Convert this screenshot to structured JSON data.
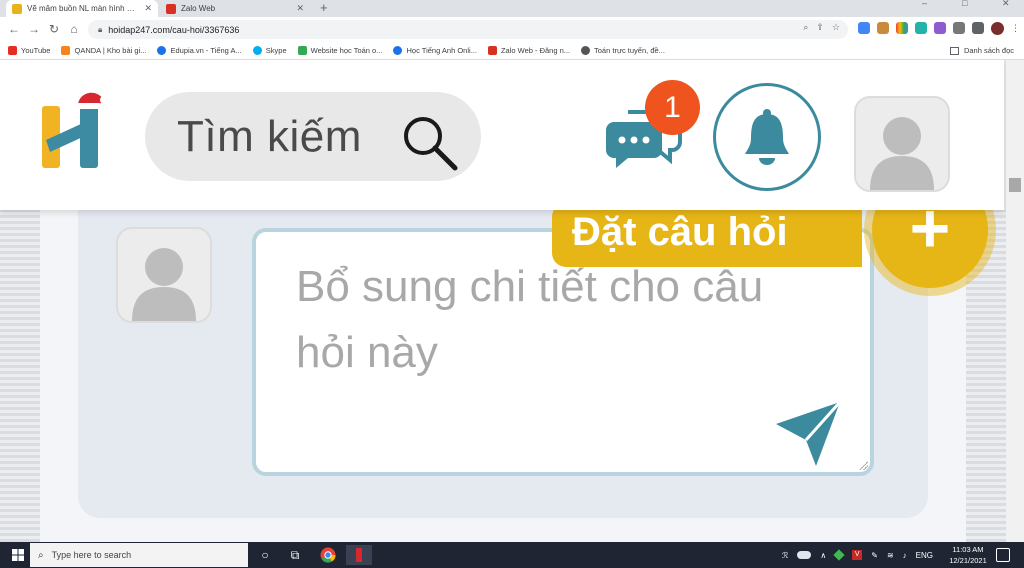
{
  "browser": {
    "tabs": [
      {
        "title": "Vẽ mâm buồn NL màn hình máy",
        "active": true,
        "favicon_color": "#e8b21b"
      },
      {
        "title": "Zalo Web",
        "active": false,
        "favicon_color": "#d93025"
      }
    ],
    "new_tab_glyph": "+",
    "window_controls": [
      "–",
      "□",
      "✕"
    ],
    "url": "hoidap247.com/cau-hoi/3367636",
    "bookmarks": [
      {
        "label": "YouTube",
        "color": "#e52d27"
      },
      {
        "label": "QANDA | Kho bài gi...",
        "color": "#f5841f"
      },
      {
        "label": "Edupia.vn - Tiếng A...",
        "color": "#1a73e8"
      },
      {
        "label": "Skype",
        "color": "#00aff0"
      },
      {
        "label": "Website học Toán o...",
        "color": "#34a853"
      },
      {
        "label": "Học Tiếng Anh Onli...",
        "color": "#1a73e8"
      },
      {
        "label": "Zalo Web - Đăng n...",
        "color": "#d93025"
      },
      {
        "label": "Toán trực tuyến, đề...",
        "color": "#555555"
      }
    ],
    "reading_list_label": "Danh sách đọc"
  },
  "site": {
    "search_placeholder": "Tìm kiếm",
    "message_badge_count": "1",
    "compose_placeholder": "Bổ sung chi tiết cho câu hỏi này",
    "ask_button_label": "Đặt câu hỏi",
    "ask_plus_glyph": "+",
    "colors": {
      "teal": "#3c8a9e",
      "orange_badge": "#f0541e",
      "gold": "#e6b516",
      "logo_yellow": "#f0b323",
      "logo_blue": "#3d8ba3",
      "santa_red": "#d7282f"
    }
  },
  "taskbar": {
    "search_placeholder": "Type here to search",
    "language": "ENG",
    "time": "11:03 AM",
    "date": "12/21/2021"
  }
}
